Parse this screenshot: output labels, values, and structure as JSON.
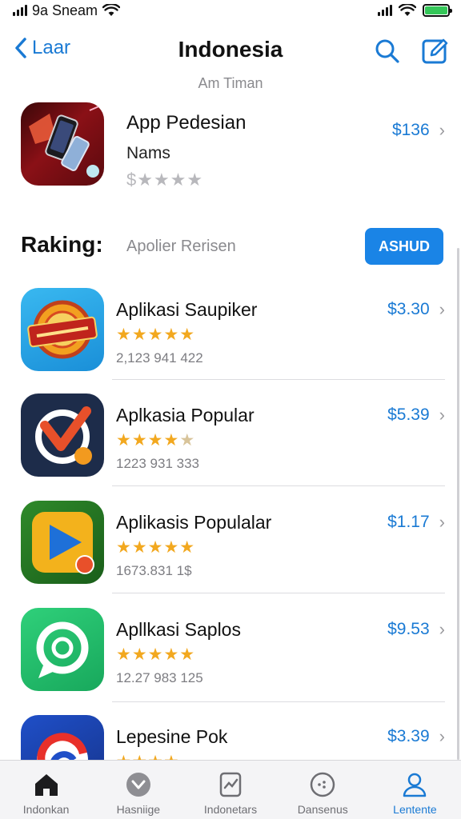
{
  "status_bar": {
    "time": "9a Sneam"
  },
  "nav": {
    "back_label": "Laar",
    "title": "Indonesia"
  },
  "subtitle": "Am Timan",
  "featured": {
    "name": "App Pedesian",
    "developer": "Nams",
    "rating_text": "$★★★★",
    "price": "$136"
  },
  "section": {
    "title": "Raking:",
    "subtitle": "Apolier Rerisen",
    "button_label": "ASHUD"
  },
  "apps": [
    {
      "name": "Aplikasi Saupiker",
      "stars": "★★★★★",
      "stars_off": "",
      "count": "2,123 941 422",
      "price": "$3.30"
    },
    {
      "name": "Aplkasia Popular",
      "stars": "★★★★",
      "stars_off": "★",
      "count": "1223 931 333",
      "price": "$5.39"
    },
    {
      "name": "Aplikasis Populalar",
      "stars": "★★★★★",
      "stars_off": "",
      "count": "1673.831 1$",
      "price": "$1.17"
    },
    {
      "name": "Apllkasi Saplos",
      "stars": "★★★★★",
      "stars_off": "",
      "count": "12.27 983 125",
      "price": "$9.53"
    },
    {
      "name": "Lepesine Pok",
      "stars": "★★★★",
      "stars_off": "",
      "count": "",
      "price": "$3.39"
    }
  ],
  "tabs": [
    {
      "label": "Indonkan",
      "icon": "home-icon"
    },
    {
      "label": "Hasniige",
      "icon": "chevron-circle-icon"
    },
    {
      "label": "Indonetars",
      "icon": "chart-doc-icon"
    },
    {
      "label": "Dansenus",
      "icon": "dots-circle-icon"
    },
    {
      "label": "Lentente",
      "icon": "person-icon"
    }
  ],
  "colors": {
    "accent": "#1a7ad4",
    "star": "#f2a81f",
    "battery": "#35c759"
  }
}
